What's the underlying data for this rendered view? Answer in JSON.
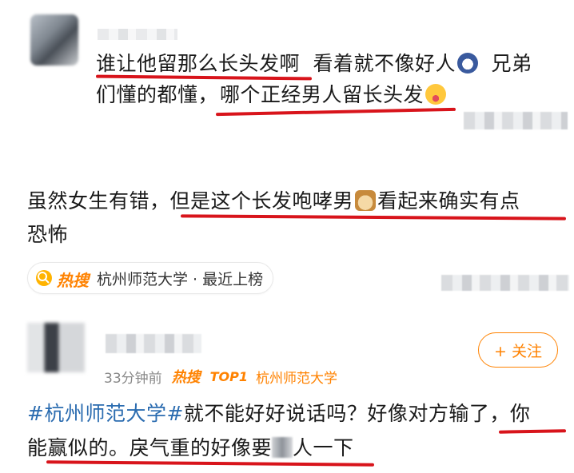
{
  "comment1": {
    "line1_part1": "谁让他留那么长头发啊",
    "line1_part2": "看着就不像好人",
    "line1_part3": "兄弟",
    "line2_part1": "们懂的都懂，",
    "line2_part2": "哪个正经男人留长头发"
  },
  "comment2": {
    "line1_part1": "虽然女生有错，",
    "line1_part2": "但是这个长发咆哮男",
    "line1_part3": "看起来确实有点",
    "line2": "恐怖"
  },
  "hot_chip": {
    "badge": "热搜",
    "label": "杭州师范大学 · 最近上榜"
  },
  "post": {
    "follow_label": "+ 关注",
    "time": "33分钟前",
    "hot_badge": "热搜",
    "top_badge": "TOP1",
    "hot_topic": "杭州师范大学",
    "line1_hashtag": "#杭州师范大学#",
    "line1_rest": "就不能好好说话吗？好像对方输了，你",
    "line2_part1": "能赢似的。",
    "line2_part2": "戾气重的好像要",
    "line2_part3": "人一下"
  },
  "colors": {
    "accent_orange": "#ff8200",
    "underline_red": "#d8141b",
    "hashtag_blue": "#2b6cb0"
  },
  "icons": [
    "blurred-avatar",
    "scared-emoji",
    "tongue-emoji",
    "cat-emoji",
    "hot-search-icon"
  ]
}
